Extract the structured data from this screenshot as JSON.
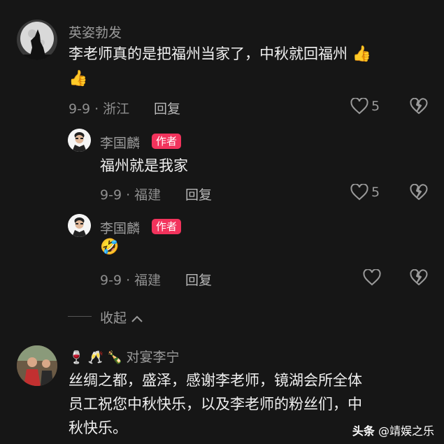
{
  "comment1": {
    "username": "英姿勃发",
    "text_line1": "李老师真的是把福州当家了，中秋就回福州",
    "date_loc": "9-9 · 浙江",
    "reply": "回复",
    "likes": "5"
  },
  "reply1": {
    "username": "李国麟",
    "badge": "作者",
    "text": "福州就是我家",
    "date_loc": "9-9 · 福建",
    "reply": "回复",
    "likes": "5"
  },
  "reply2": {
    "username": "李国麟",
    "badge": "作者",
    "date_loc": "9-9 · 福建",
    "reply": "回复"
  },
  "collapse": {
    "label": "收起"
  },
  "comment2": {
    "username": "对宴李宁",
    "line1": "丝绸之都，盛泽，感谢李老师，镜湖会所全体",
    "line2": "员工祝您中秋快乐，以及李老师的粉丝们，中",
    "line3": "秋快乐。"
  },
  "watermark": {
    "brand": "头条",
    "handle": "@靖娱之乐"
  }
}
